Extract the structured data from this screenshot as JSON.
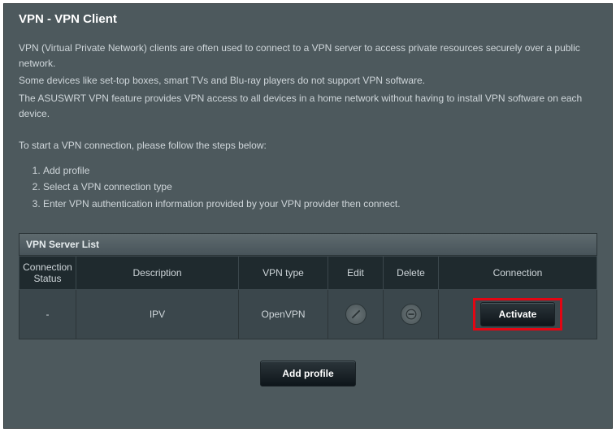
{
  "title": "VPN - VPN Client",
  "description": {
    "p1": "VPN (Virtual Private Network) clients are often used to connect to a VPN server to access private resources securely over a public network.",
    "p2": "Some devices like set-top boxes, smart TVs and Blu-ray players do not support VPN software.",
    "p3": "The ASUSWRT VPN feature provides VPN access to all devices in a home network without having to install VPN software on each device."
  },
  "steps_intro": "To start a VPN connection, please follow the steps below:",
  "steps": [
    "Add profile",
    "Select a VPN connection type",
    "Enter VPN authentication information provided by your VPN provider then connect."
  ],
  "server_list": {
    "title": "VPN Server List",
    "columns": {
      "status": "Connection Status",
      "description": "Description",
      "type": "VPN type",
      "edit": "Edit",
      "delete": "Delete",
      "connection": "Connection"
    },
    "rows": [
      {
        "status": "-",
        "description": "IPV",
        "type": "OpenVPN",
        "action": "Activate"
      }
    ]
  },
  "add_profile_label": "Add profile"
}
